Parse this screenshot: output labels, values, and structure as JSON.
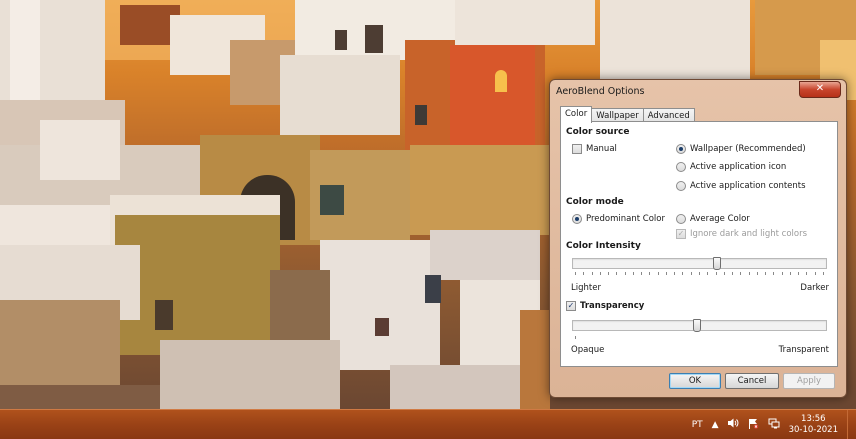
{
  "dialog": {
    "title": "AeroBlend Options",
    "close_glyph": "✕",
    "tabs": [
      {
        "label": "Color",
        "active": true
      },
      {
        "label": "Wallpaper",
        "active": false
      },
      {
        "label": "Advanced",
        "active": false
      }
    ],
    "color_source": {
      "heading": "Color source",
      "manual_label": "Manual",
      "manual_checked": false,
      "options": [
        {
          "label": "Wallpaper (Recommended)",
          "selected": true
        },
        {
          "label": "Active application icon",
          "selected": false
        },
        {
          "label": "Active application contents",
          "selected": false
        }
      ]
    },
    "color_mode": {
      "heading": "Color mode",
      "predominant_label": "Predominant Color",
      "predominant_selected": true,
      "average_label": "Average Color",
      "average_selected": false,
      "ignore_label": "Ignore dark and light colors",
      "ignore_checked": true,
      "ignore_enabled": false
    },
    "intensity": {
      "heading": "Color Intensity",
      "value_fraction": 0.57,
      "min_label": "Lighter",
      "max_label": "Darker"
    },
    "transparency": {
      "label": "Transparency",
      "checked": true,
      "value_fraction": 0.49,
      "min_label": "Opaque",
      "max_label": "Transparent"
    },
    "buttons": {
      "ok": "OK",
      "cancel": "Cancel",
      "apply": "Apply"
    }
  },
  "taskbar": {
    "language": "PT",
    "time": "13:56",
    "date": "30-10-2021",
    "icons": [
      "show-hidden-icons-icon",
      "volume-icon",
      "action-center-flag-icon",
      "network-icon"
    ]
  },
  "colors": {
    "taskbar": "#9a4216",
    "window_frame": "#dbb396",
    "close_button": "#c8452c"
  }
}
